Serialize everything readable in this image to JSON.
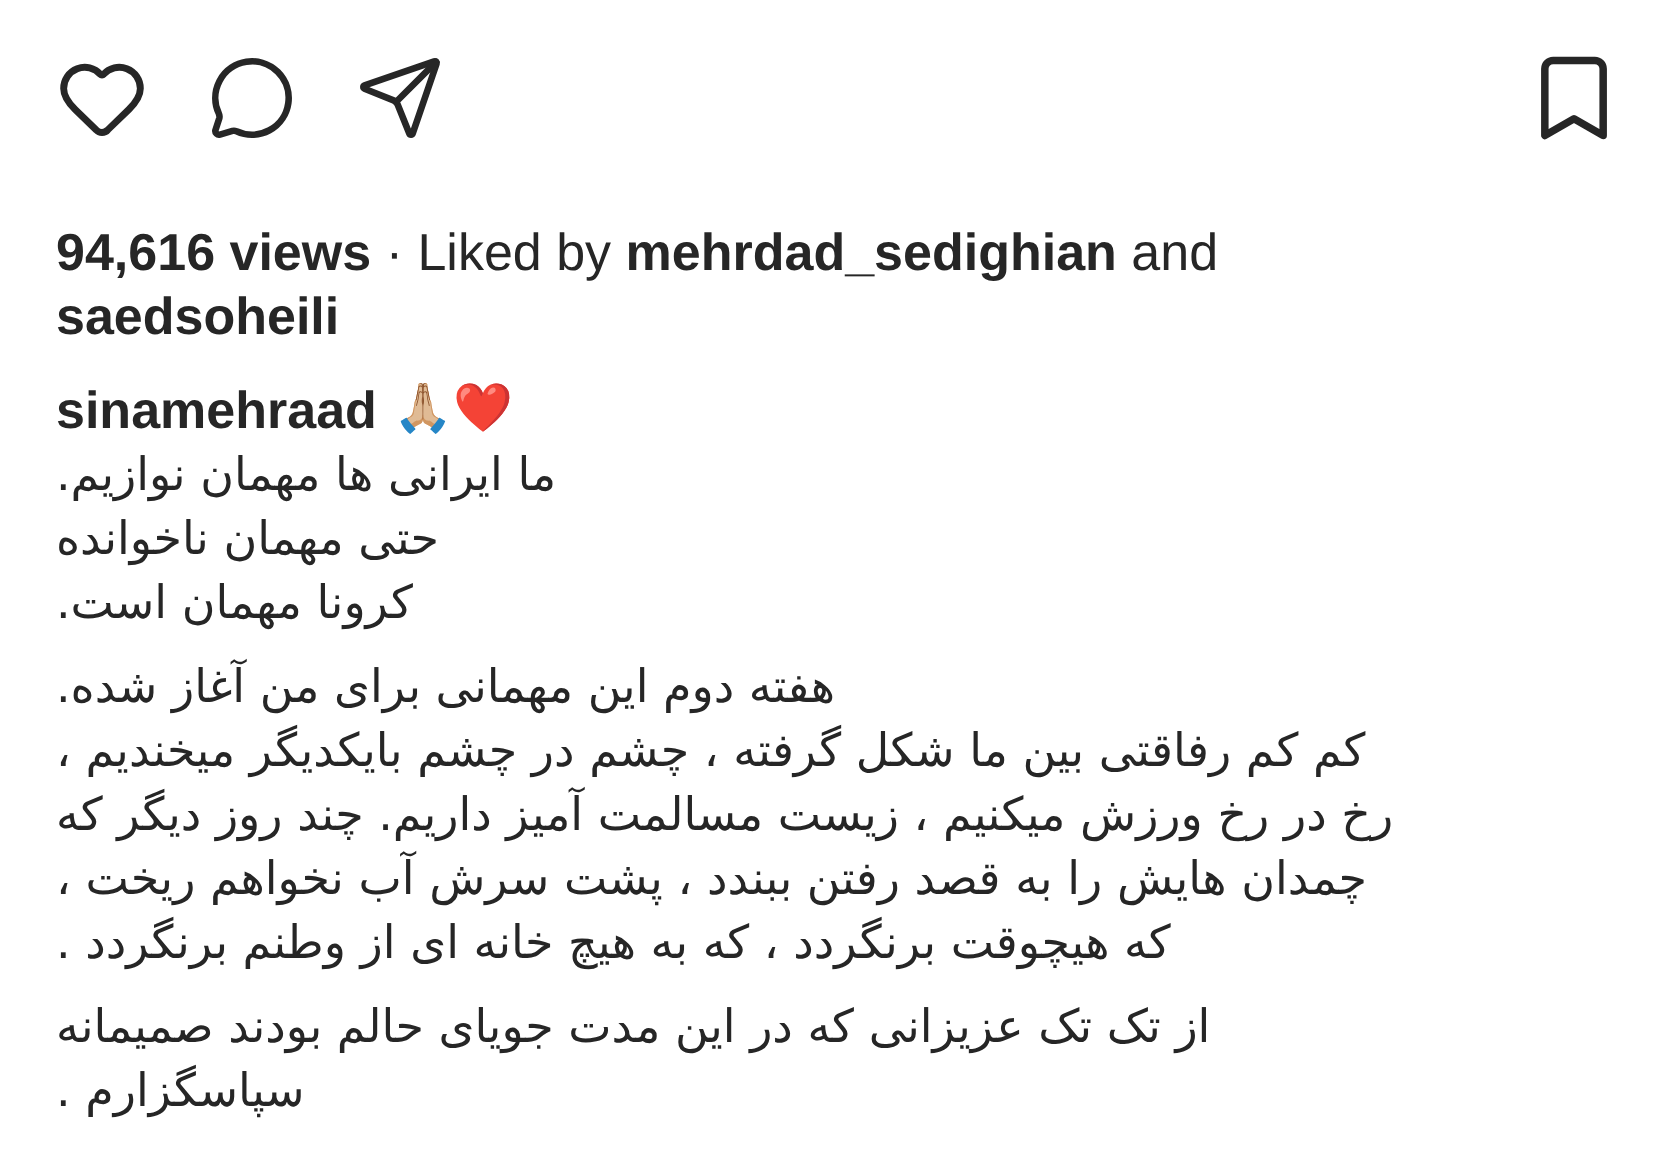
{
  "post": {
    "liked": false,
    "saved": false,
    "views": "94,616 views",
    "separator": "·",
    "liked_by_prefix": "Liked by",
    "liked_by_user": "mehrdad_sedighian",
    "liked_by_and": "and",
    "liked_by_other": "saedsoheili",
    "author": "sinamehraad",
    "author_emoji": "🙏🏼❤️",
    "caption_lines": [
      "ما ایرانی ها مهمان نوازیم.",
      "حتی مهمان ناخوانده",
      "کرونا مهمان است.",
      "هفته دوم این مهمانی برای من آغاز شده.",
      "کم کم رفاقتی بین ما شکل گرفته ، چشم در چشم بایکدیگر میخندیم ،",
      "رخ در رخ ورزش میکنیم ، زیست مسالمت آمیز داریم. چند روز دیگر که",
      "چمدان هایش را به قصد رفتن ببندد ، پشت سرش آب نخواهم ریخت ،",
      "که هیچوقت برنگردد ، که به هیچ خانه ای از وطنم برنگردد .",
      "از تک تک عزیزانی که در این مدت جویای حالم بودند صمیمانه",
      "سپاسگزارم ."
    ]
  }
}
